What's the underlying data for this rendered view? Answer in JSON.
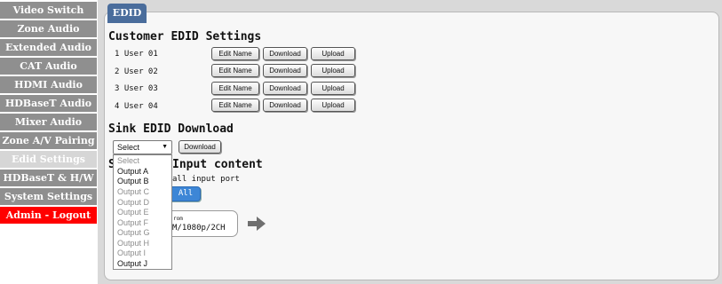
{
  "sidebar": {
    "items": [
      {
        "label": "Video Switch",
        "state": "normal"
      },
      {
        "label": "Zone Audio",
        "state": "normal"
      },
      {
        "label": "Extended Audio",
        "state": "normal"
      },
      {
        "label": "CAT Audio",
        "state": "normal"
      },
      {
        "label": "HDMI Audio",
        "state": "normal"
      },
      {
        "label": "HDBaseT Audio",
        "state": "normal"
      },
      {
        "label": "Mixer Audio",
        "state": "normal"
      },
      {
        "label": "Zone A/V Pairing",
        "state": "normal"
      },
      {
        "label": "Edid Settings",
        "state": "active"
      },
      {
        "label": "HDBaseT & H/W",
        "state": "normal"
      },
      {
        "label": "System Settings",
        "state": "normal"
      },
      {
        "label": "Admin - Logout",
        "state": "danger"
      }
    ]
  },
  "tab": {
    "label": "EDID"
  },
  "customer_edid": {
    "title": "Customer EDID Settings",
    "rows": [
      {
        "label": "1 User 01",
        "edit": "Edit Name",
        "download": "Download",
        "upload": "Upload"
      },
      {
        "label": "2 User 02",
        "edit": "Edit Name",
        "download": "Download",
        "upload": "Upload"
      },
      {
        "label": "3 User 03",
        "edit": "Edit Name",
        "download": "Download",
        "upload": "Upload"
      },
      {
        "label": "4 User 04",
        "edit": "Edit Name",
        "download": "Download",
        "upload": "Upload"
      }
    ]
  },
  "sink_edid": {
    "title": "Sink EDID Download",
    "select_value": "Select",
    "download_label": "Download",
    "options": [
      {
        "label": "Select",
        "enabled": false
      },
      {
        "label": "Output A",
        "enabled": true
      },
      {
        "label": "Output B",
        "enabled": true
      },
      {
        "label": "Output C",
        "enabled": false
      },
      {
        "label": "Output D",
        "enabled": false
      },
      {
        "label": "Output E",
        "enabled": false
      },
      {
        "label": "Output F",
        "enabled": false
      },
      {
        "label": "Output G",
        "enabled": false
      },
      {
        "label": "Output H",
        "enabled": false
      },
      {
        "label": "Output I",
        "enabled": false
      },
      {
        "label": "Output J",
        "enabled": true
      }
    ]
  },
  "input_content": {
    "title_visible_start": "S",
    "title_visible_end": "Input content",
    "all_port_text": "all input port",
    "all_button": "All",
    "from_label": "rom",
    "from_value": "M/1080p/2CH"
  },
  "colors": {
    "sidebar_bg": "#8f8f8f",
    "sidebar_active": "#d6d6d6",
    "logout_red": "#ff0000",
    "tab_blue": "#4a6d9c",
    "all_button_blue": "#3d86d6"
  },
  "icons": {
    "arrow": "arrow-right-icon",
    "select_caret": "caret-down-icon"
  }
}
